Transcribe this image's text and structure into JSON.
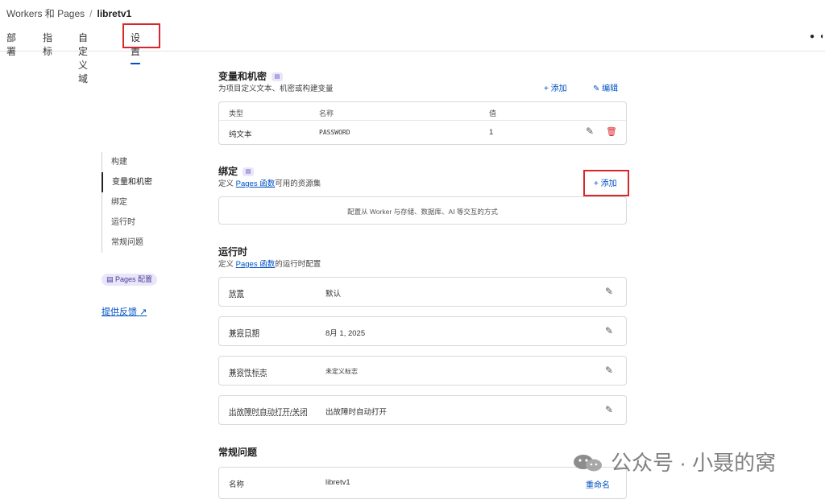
{
  "breadcrumb": {
    "parent": "Workers 和 Pages",
    "separator": "/",
    "current": "libretv1"
  },
  "tabs": [
    {
      "label": "部署"
    },
    {
      "label": "指标"
    },
    {
      "label": "自定义域"
    },
    {
      "label": "设置"
    }
  ],
  "leftnav": {
    "items": [
      {
        "label": "构建"
      },
      {
        "label": "变量和机密"
      },
      {
        "label": "绑定"
      },
      {
        "label": "运行时"
      },
      {
        "label": "常规问题"
      }
    ],
    "pages_badge": "Pages 配置",
    "feedback": "提供反馈"
  },
  "vars": {
    "title": "变量和机密",
    "desc": "为项目定义文本、机密或构建变量",
    "add": "+ 添加",
    "edit": "编辑",
    "table": {
      "headers": [
        "类型",
        "名称",
        "值"
      ],
      "rows": [
        {
          "type": "纯文本",
          "name": "PASSWORD",
          "value": "1"
        }
      ]
    }
  },
  "bindings": {
    "title": "绑定",
    "desc_prefix": "定义",
    "desc_link": "Pages 函数",
    "desc_suffix": "可用的资源集",
    "add": "+ 添加",
    "empty": "配置从 Worker 与存储、数据库、AI 等交互的方式"
  },
  "runtime": {
    "title": "运行时",
    "desc_prefix": "定义",
    "desc_link": "Pages 函数",
    "desc_suffix": "的运行时配置",
    "rows": [
      {
        "label": "放置",
        "value": "默认"
      },
      {
        "label": "兼容日期",
        "value": "8月 1, 2025"
      },
      {
        "label": "兼容性标志",
        "value": "未定义标志"
      },
      {
        "label": "出故障时自动打开/关闭",
        "value": "出故障时自动打开"
      }
    ]
  },
  "general": {
    "title": "常规问题",
    "name_label": "名称",
    "name_value": "libretv1",
    "rename": "重命名"
  },
  "watermark": {
    "text": "公众号 · 小聂的窝"
  },
  "colors": {
    "accent": "#0051c3",
    "highlight": "#d9262c"
  }
}
